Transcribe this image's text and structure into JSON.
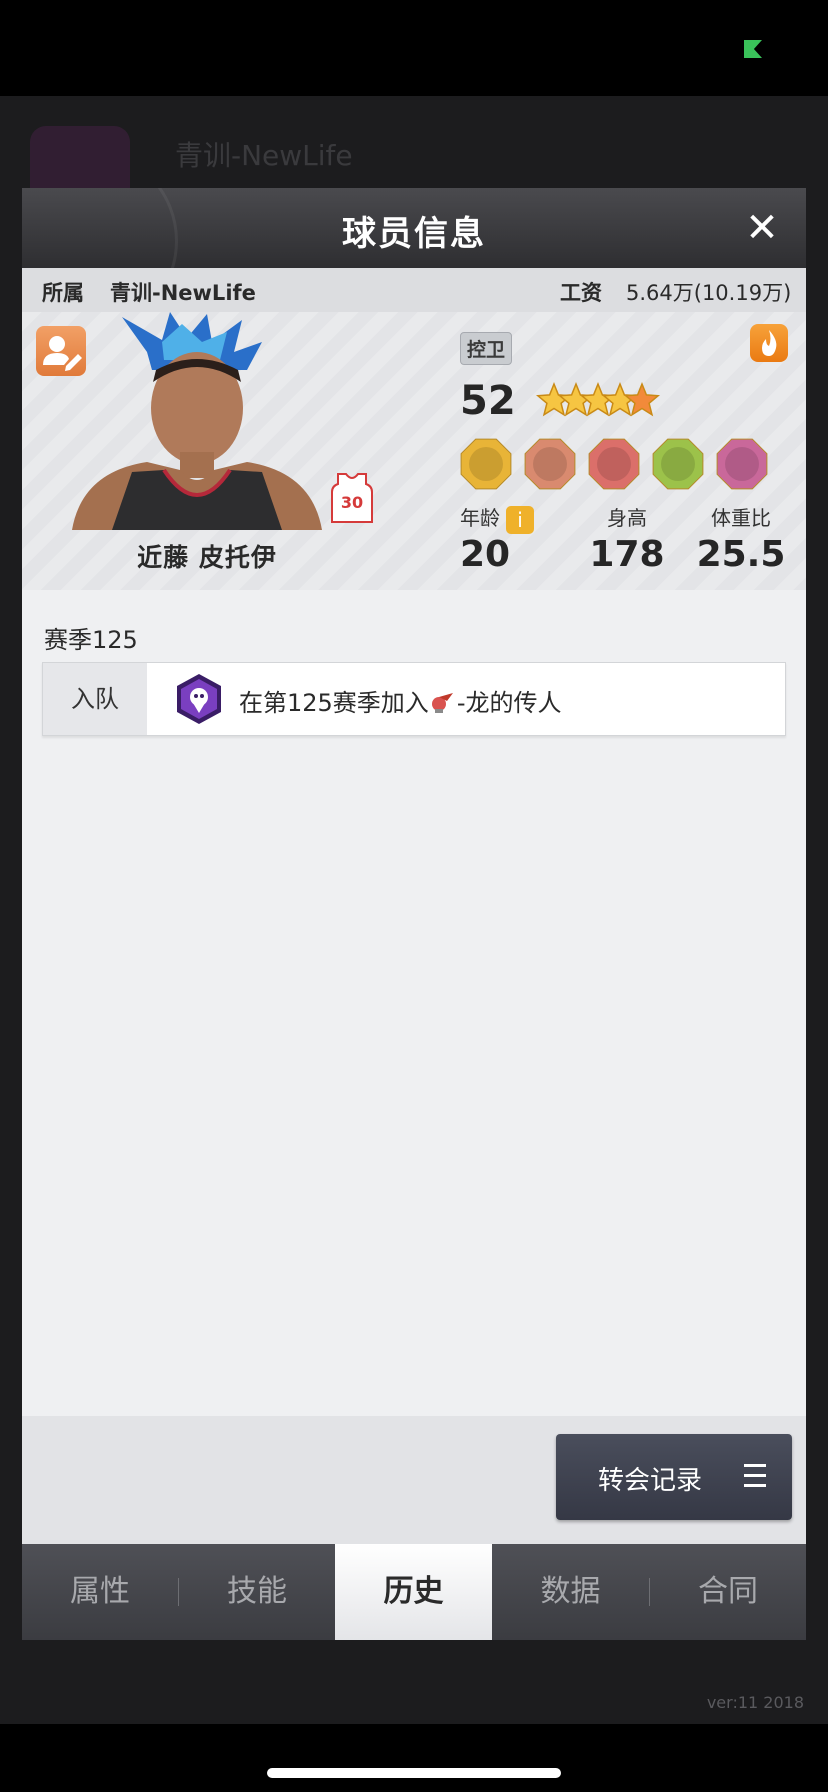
{
  "modal": {
    "title": "球员信息",
    "close_label": "✕"
  },
  "info_bar": {
    "team_label": "所属",
    "team_value": "青训-NewLife",
    "salary_label": "工资",
    "salary_value": "5.64万(10.19万)"
  },
  "player": {
    "name": "近藤 皮托伊",
    "jersey_number": "30",
    "position": "控卫",
    "rating": "52",
    "stars": 4.5,
    "stats": [
      {
        "label": "年龄",
        "value": "20"
      },
      {
        "label": "身高",
        "value": "178"
      },
      {
        "label": "体重比",
        "value": "25.5"
      }
    ],
    "info_glyph": "i",
    "skill_badge_colors": [
      "#e8b437",
      "#d98a6f",
      "#db6f6a",
      "#9cc24a",
      "#c9689a"
    ]
  },
  "history": {
    "season_label": "赛季125",
    "rows": [
      {
        "type": "入队",
        "text_before": "在第125赛季加入",
        "text_after": "-龙的传人"
      }
    ]
  },
  "transfer_button": {
    "label": "转会记录"
  },
  "tabs": [
    {
      "label": "属性",
      "active": false
    },
    {
      "label": "技能",
      "active": false
    },
    {
      "label": "历史",
      "active": true
    },
    {
      "label": "数据",
      "active": false
    },
    {
      "label": "合同",
      "active": false
    }
  ],
  "background": {
    "team_name": "青训-NewLife",
    "version": "ver:11  2018"
  }
}
